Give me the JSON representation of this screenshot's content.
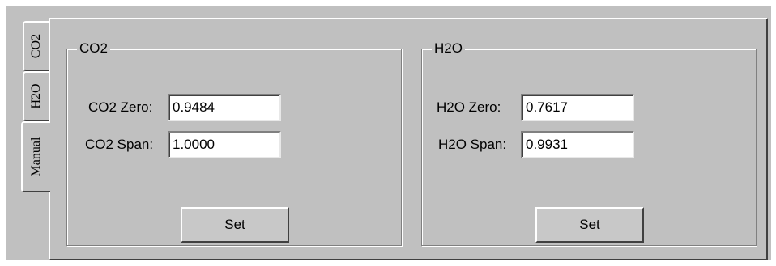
{
  "tabs": {
    "co2": "CO2",
    "h2o": "H2O",
    "manual": "Manual"
  },
  "co2_group": {
    "title": "CO2",
    "zero_label": "CO2 Zero:",
    "zero_value": "0.9484",
    "span_label": "CO2 Span:",
    "span_value": "1.0000",
    "set_label": "Set"
  },
  "h2o_group": {
    "title": "H2O",
    "zero_label": "H2O Zero:",
    "zero_value": "0.7617",
    "span_label": "H2O Span:",
    "span_value": "0.9931",
    "set_label": "Set"
  }
}
